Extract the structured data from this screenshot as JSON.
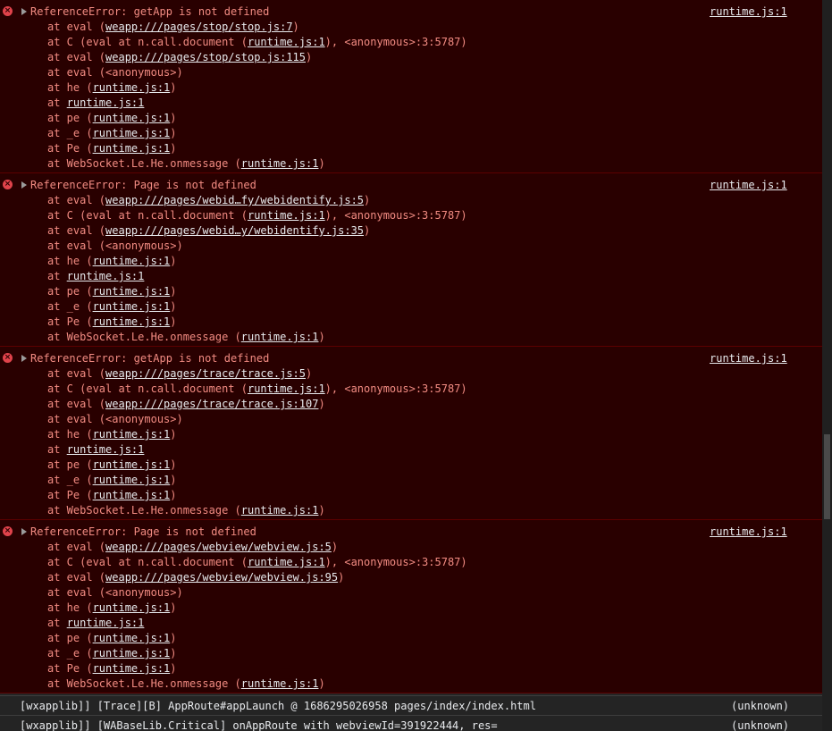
{
  "errors": [
    {
      "message": "ReferenceError: getApp is not defined",
      "source": "runtime.js:1",
      "stack": [
        {
          "pre": "at eval (",
          "link": "weapp:///pages/stop/stop.js:7",
          "post": ")"
        },
        {
          "pre": "at C (eval at n.call.document (",
          "link": "runtime.js:1",
          "post": "), <anonymous>:3:5787)"
        },
        {
          "pre": "at eval (",
          "link": "weapp:///pages/stop/stop.js:115",
          "post": ")"
        },
        {
          "pre": "at eval (<anonymous>)",
          "link": "",
          "post": ""
        },
        {
          "pre": "at he (",
          "link": "runtime.js:1",
          "post": ")"
        },
        {
          "pre": "at ",
          "link": "runtime.js:1",
          "post": ""
        },
        {
          "pre": "at pe (",
          "link": "runtime.js:1",
          "post": ")"
        },
        {
          "pre": "at _e (",
          "link": "runtime.js:1",
          "post": ")"
        },
        {
          "pre": "at Pe (",
          "link": "runtime.js:1",
          "post": ")"
        },
        {
          "pre": "at WebSocket.Le.He.onmessage (",
          "link": "runtime.js:1",
          "post": ")"
        }
      ]
    },
    {
      "message": "ReferenceError: Page is not defined",
      "source": "runtime.js:1",
      "stack": [
        {
          "pre": "at eval (",
          "link": "weapp:///pages/webid…fy/webidentify.js:5",
          "post": ")"
        },
        {
          "pre": "at C (eval at n.call.document (",
          "link": "runtime.js:1",
          "post": "), <anonymous>:3:5787)"
        },
        {
          "pre": "at eval (",
          "link": "weapp:///pages/webid…y/webidentify.js:35",
          "post": ")"
        },
        {
          "pre": "at eval (<anonymous>)",
          "link": "",
          "post": ""
        },
        {
          "pre": "at he (",
          "link": "runtime.js:1",
          "post": ")"
        },
        {
          "pre": "at ",
          "link": "runtime.js:1",
          "post": ""
        },
        {
          "pre": "at pe (",
          "link": "runtime.js:1",
          "post": ")"
        },
        {
          "pre": "at _e (",
          "link": "runtime.js:1",
          "post": ")"
        },
        {
          "pre": "at Pe (",
          "link": "runtime.js:1",
          "post": ")"
        },
        {
          "pre": "at WebSocket.Le.He.onmessage (",
          "link": "runtime.js:1",
          "post": ")"
        }
      ]
    },
    {
      "message": "ReferenceError: getApp is not defined",
      "source": "runtime.js:1",
      "stack": [
        {
          "pre": "at eval (",
          "link": "weapp:///pages/trace/trace.js:5",
          "post": ")"
        },
        {
          "pre": "at C (eval at n.call.document (",
          "link": "runtime.js:1",
          "post": "), <anonymous>:3:5787)"
        },
        {
          "pre": "at eval (",
          "link": "weapp:///pages/trace/trace.js:107",
          "post": ")"
        },
        {
          "pre": "at eval (<anonymous>)",
          "link": "",
          "post": ""
        },
        {
          "pre": "at he (",
          "link": "runtime.js:1",
          "post": ")"
        },
        {
          "pre": "at ",
          "link": "runtime.js:1",
          "post": ""
        },
        {
          "pre": "at pe (",
          "link": "runtime.js:1",
          "post": ")"
        },
        {
          "pre": "at _e (",
          "link": "runtime.js:1",
          "post": ")"
        },
        {
          "pre": "at Pe (",
          "link": "runtime.js:1",
          "post": ")"
        },
        {
          "pre": "at WebSocket.Le.He.onmessage (",
          "link": "runtime.js:1",
          "post": ")"
        }
      ]
    },
    {
      "message": "ReferenceError: Page is not defined",
      "source": "runtime.js:1",
      "stack": [
        {
          "pre": "at eval (",
          "link": "weapp:///pages/webview/webview.js:5",
          "post": ")"
        },
        {
          "pre": "at C (eval at n.call.document (",
          "link": "runtime.js:1",
          "post": "), <anonymous>:3:5787)"
        },
        {
          "pre": "at eval (",
          "link": "weapp:///pages/webview/webview.js:95",
          "post": ")"
        },
        {
          "pre": "at eval (<anonymous>)",
          "link": "",
          "post": ""
        },
        {
          "pre": "at he (",
          "link": "runtime.js:1",
          "post": ")"
        },
        {
          "pre": "at ",
          "link": "runtime.js:1",
          "post": ""
        },
        {
          "pre": "at pe (",
          "link": "runtime.js:1",
          "post": ")"
        },
        {
          "pre": "at _e (",
          "link": "runtime.js:1",
          "post": ")"
        },
        {
          "pre": "at Pe (",
          "link": "runtime.js:1",
          "post": ")"
        },
        {
          "pre": "at WebSocket.Le.He.onmessage (",
          "link": "runtime.js:1",
          "post": ")"
        }
      ]
    }
  ],
  "logs": [
    {
      "text": "[wxapplib]] [Trace][B] AppRoute#appLaunch @ 1686295026958 pages/index/index.html",
      "source": "(unknown)"
    },
    {
      "text": "[wxapplib]] [WABaseLib.Critical] onAppRoute with webviewId=391922444, res=",
      "source": "(unknown)"
    }
  ],
  "icons": {
    "error": "error-circle-icon",
    "expand": "expand-triangle-icon"
  },
  "colors": {
    "error_bg": "#290000",
    "error_text": "#f28b82",
    "link": "#e8eaed",
    "error_icon": "#e0434b"
  }
}
